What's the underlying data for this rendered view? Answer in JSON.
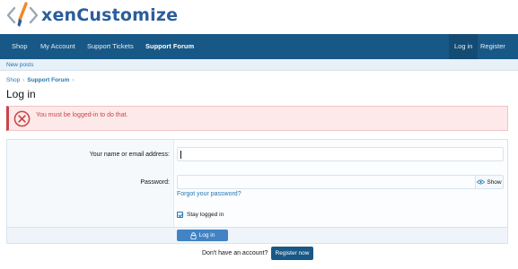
{
  "brand": {
    "name": "xenCustomize"
  },
  "nav": {
    "items": [
      {
        "label": "Shop"
      },
      {
        "label": "My Account"
      },
      {
        "label": "Support Tickets"
      },
      {
        "label": "Support Forum"
      }
    ],
    "login_label": "Log in",
    "register_label": "Register"
  },
  "subnav": {
    "new_posts_label": "New posts"
  },
  "breadcrumb": {
    "items": [
      {
        "label": "Shop"
      },
      {
        "label": "Support Forum"
      }
    ]
  },
  "page": {
    "title": "Log in"
  },
  "error": {
    "message": "You must be logged-in to do that."
  },
  "form": {
    "username_label": "Your name or email address:",
    "username_value": "",
    "password_label": "Password:",
    "password_value": "",
    "show_label": "Show",
    "forgot_label": "Forgot your password?",
    "stay_logged_in_label": "Stay logged in",
    "stay_logged_in_checked": true,
    "submit_label": "Log in"
  },
  "footer": {
    "no_account_text": "Don't have an account?",
    "register_now_label": "Register now"
  },
  "colors": {
    "nav_bg": "#185886",
    "accent": "#2577b1",
    "error": "#c84448",
    "button": "#4183c4"
  }
}
